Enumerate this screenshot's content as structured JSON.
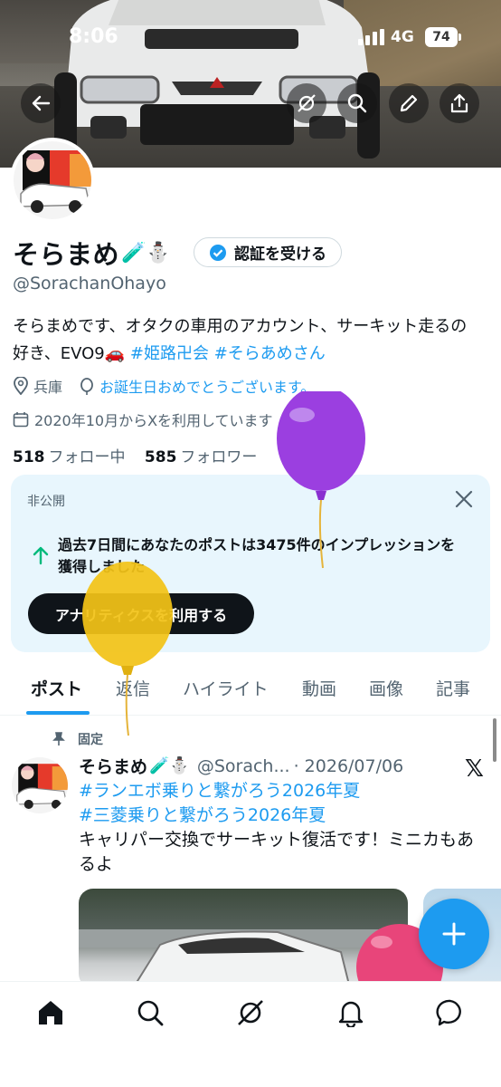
{
  "status_bar": {
    "time": "8:06",
    "network": "4G",
    "battery": "74"
  },
  "header": {
    "back_icon": "arrow-left-icon",
    "grok_icon": "grok-icon",
    "search_icon": "search-icon",
    "edit_icon": "pencil-icon",
    "share_icon": "share-icon"
  },
  "profile": {
    "name": "そらまめ",
    "name_emoji": "🧪⛄",
    "verify_label": "認証を受ける",
    "handle": "@SorachanOhayo",
    "bio_text": "そらまめです、オタクの車用のアカウント、サーキット走るの好き、EVO9",
    "bio_emoji": "🚗",
    "bio_tag1": "#姫路卍会",
    "bio_tag2": "#そらあめさん",
    "location": "兵庫",
    "birthday": "お誕生日おめでとうございます。",
    "joined": "2020年10月からXを利用しています",
    "following_count": "518",
    "following_label": "フォロー中",
    "followers_count": "585",
    "followers_label": "フォロワー"
  },
  "private_card": {
    "label": "非公開",
    "text": "過去7日間にあなたのポストは3475件のインプレッションを獲得しました",
    "button": "アナリティクスを利用する"
  },
  "tabs": [
    "ポスト",
    "返信",
    "ハイライト",
    "動画",
    "画像",
    "記事"
  ],
  "post": {
    "pinned": "固定",
    "name": "そらまめ",
    "name_emoji": "🧪⛄",
    "handle": "@Sorach...",
    "date": "· 2026/07/06",
    "tag1": "#ランエボ乗りと繋がろう2026年夏",
    "tag2": "#三菱乗りと繋がろう2026年夏",
    "text": "キャリパー交換でサーキット復活です！ミニカもあるよ",
    "x_logo": "𝕏"
  },
  "colors": {
    "accent": "#1d9bf0",
    "card_bg": "#e8f6fd",
    "balloon_purple": "#9b3fe0",
    "balloon_yellow": "#f2c318",
    "balloon_pink": "#e8457a"
  },
  "nav": [
    "home-icon",
    "search-icon",
    "grok-icon",
    "bell-icon",
    "messages-icon"
  ]
}
